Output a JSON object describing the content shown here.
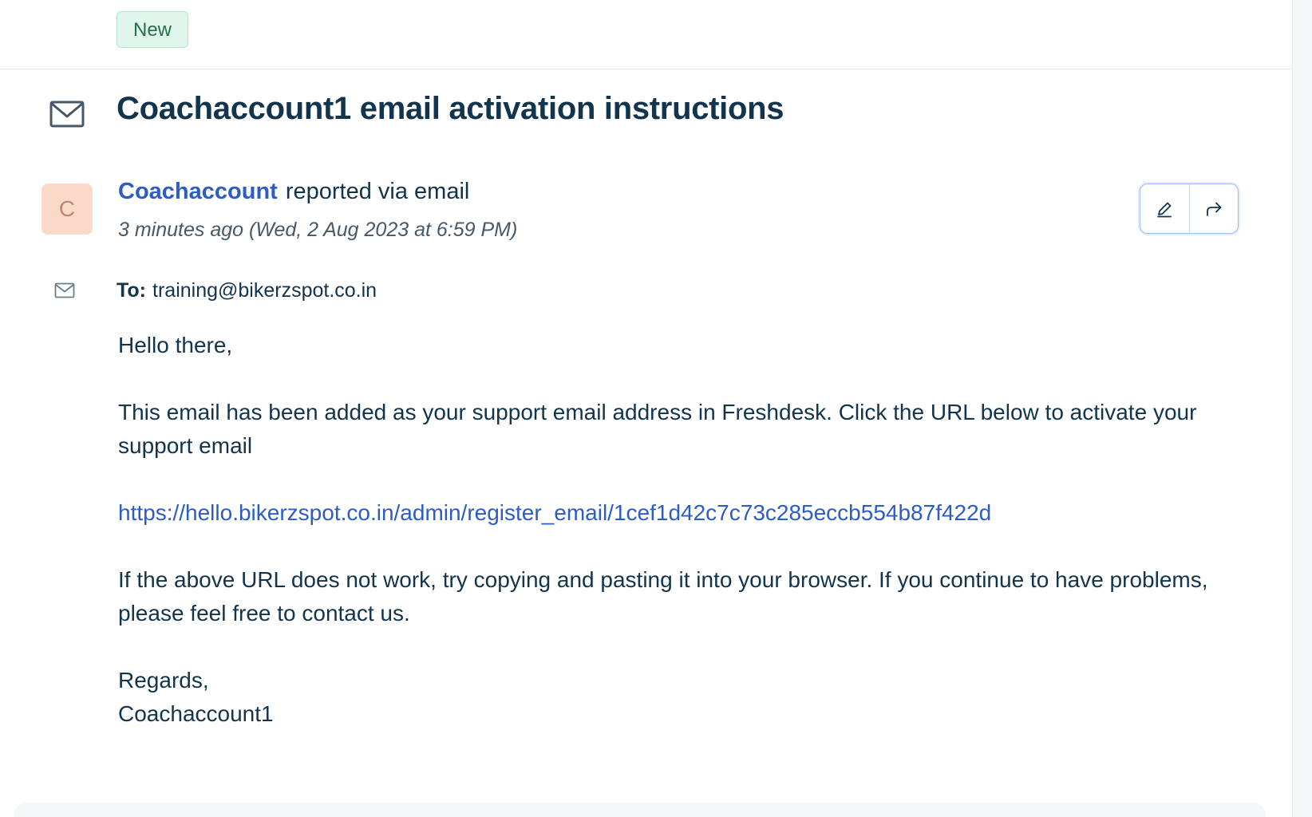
{
  "ticket": {
    "status_badge": "New",
    "title": "Coachaccount1 email activation instructions"
  },
  "sender": {
    "avatar_initial": "C",
    "name": "Coachaccount",
    "via_text": "reported via email",
    "time_relative": "3 minutes ago",
    "time_absolute": "(Wed, 2 Aug 2023 at 6:59 PM)"
  },
  "recipient": {
    "label": "To:",
    "address": "training@bikerzspot.co.in"
  },
  "message": {
    "greeting": "Hello there,",
    "paragraph1": "This email has been added as your support email address in Freshdesk. Click the URL below to activate your support email",
    "link": "https://hello.bikerzspot.co.in/admin/register_email/1cef1d42c7c73c285eccb554b87f422d",
    "paragraph2": "If the above URL does not work, try copying and pasting it into your browser. If you continue to have problems, please feel free to contact us.",
    "signoff": "Regards,",
    "signature": "Coachaccount1"
  },
  "actions": [
    {
      "icon": "pencil-icon"
    },
    {
      "icon": "forward-arrow-icon"
    }
  ],
  "icons": {
    "ticket_icon": "envelope-icon",
    "recipient_icon": "envelope-icon"
  },
  "colors": {
    "link": "#2c5cc5",
    "text": "#12344d",
    "badge_bg": "#e0f5ec",
    "badge_text": "#24704a",
    "avatar_bg": "#fbd9c9"
  }
}
